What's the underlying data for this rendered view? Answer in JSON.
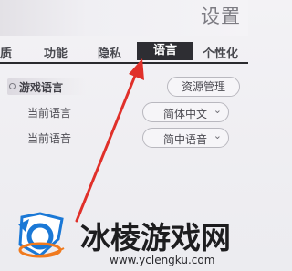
{
  "header": {
    "title": "设置"
  },
  "tabs": [
    {
      "label": "质"
    },
    {
      "label": "功能"
    },
    {
      "label": "隐私"
    },
    {
      "label": "语言",
      "active": true
    },
    {
      "label": "个性化"
    }
  ],
  "sidebar": {
    "item": "游戏语言"
  },
  "buttons": {
    "resource_manage": "资源管理"
  },
  "settings": {
    "current_language": {
      "label": "当前语言",
      "value": "简体中文"
    },
    "current_voice": {
      "label": "当前语音",
      "value": "简中语音"
    }
  },
  "watermark": {
    "brand": "冰棱游戏网",
    "url": "www.yclengku.com"
  },
  "colors": {
    "active_tab": "#2e2e33",
    "arrow": "#e0302a",
    "logo_blue": "#1a78d6",
    "logo_orange": "#f07a1e"
  }
}
